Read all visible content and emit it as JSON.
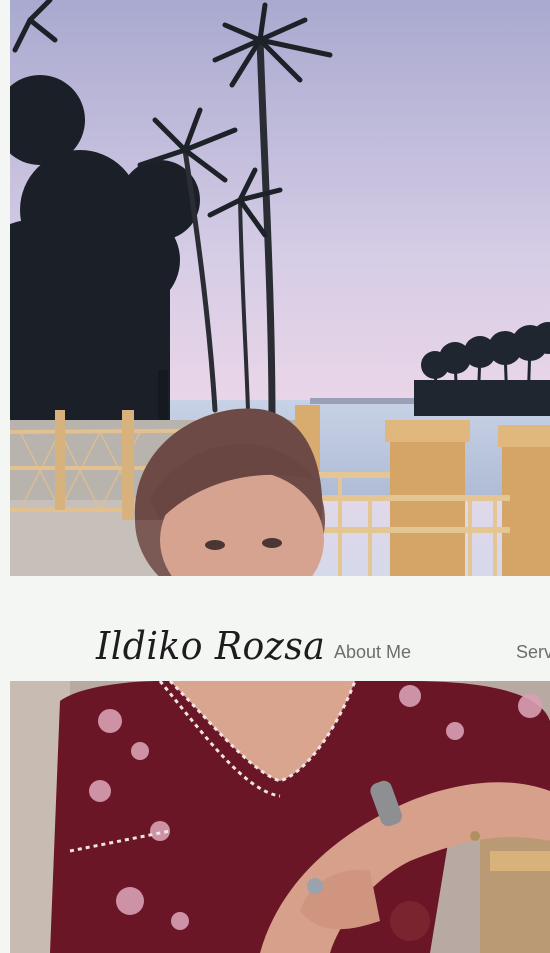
{
  "site": {
    "title": "Ildiko Rozsa"
  },
  "nav": {
    "items": [
      {
        "label": "About Me"
      },
      {
        "label": "Serv"
      }
    ]
  },
  "colors": {
    "background": "#f4f6f4",
    "title": "#1d1d1d",
    "nav_text": "#6d6d6d",
    "sky_top": "#b9b7d6",
    "sky_bottom": "#e6cfe3",
    "sea": "#c7d3e4",
    "railing": "#d9b37e",
    "dress": "#6b1424"
  },
  "images": {
    "hero": "portrait-at-palm-tree-waterfront-photo",
    "lower": "portrait-in-embroidered-dress-photo"
  }
}
